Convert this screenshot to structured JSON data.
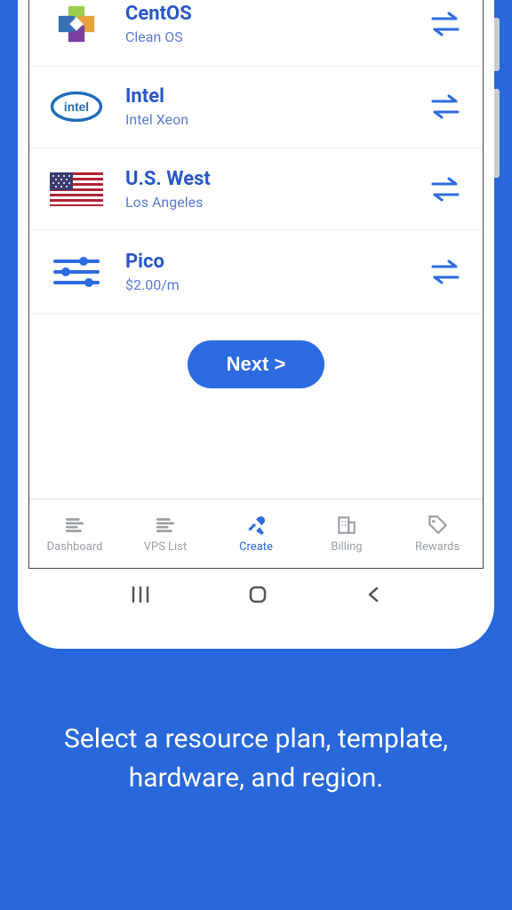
{
  "options": [
    {
      "icon": "centos",
      "title": "CentOS",
      "sub": "Clean OS"
    },
    {
      "icon": "intel",
      "title": "Intel",
      "sub": "Intel Xeon"
    },
    {
      "icon": "us-flag",
      "title": "U.S. West",
      "sub": "Los Angeles"
    },
    {
      "icon": "sliders",
      "title": "Pico",
      "sub": "$2.00/m"
    }
  ],
  "next_label": "Next >",
  "bottom_nav": [
    {
      "label": "Dashboard",
      "active": false
    },
    {
      "label": "VPS List",
      "active": false
    },
    {
      "label": "Create",
      "active": true
    },
    {
      "label": "Billing",
      "active": false
    },
    {
      "label": "Rewards",
      "active": false
    }
  ],
  "caption": "Select a resource plan, template, hardware, and region.",
  "colors": {
    "accent": "#2d6be0",
    "bg": "#2968db"
  }
}
